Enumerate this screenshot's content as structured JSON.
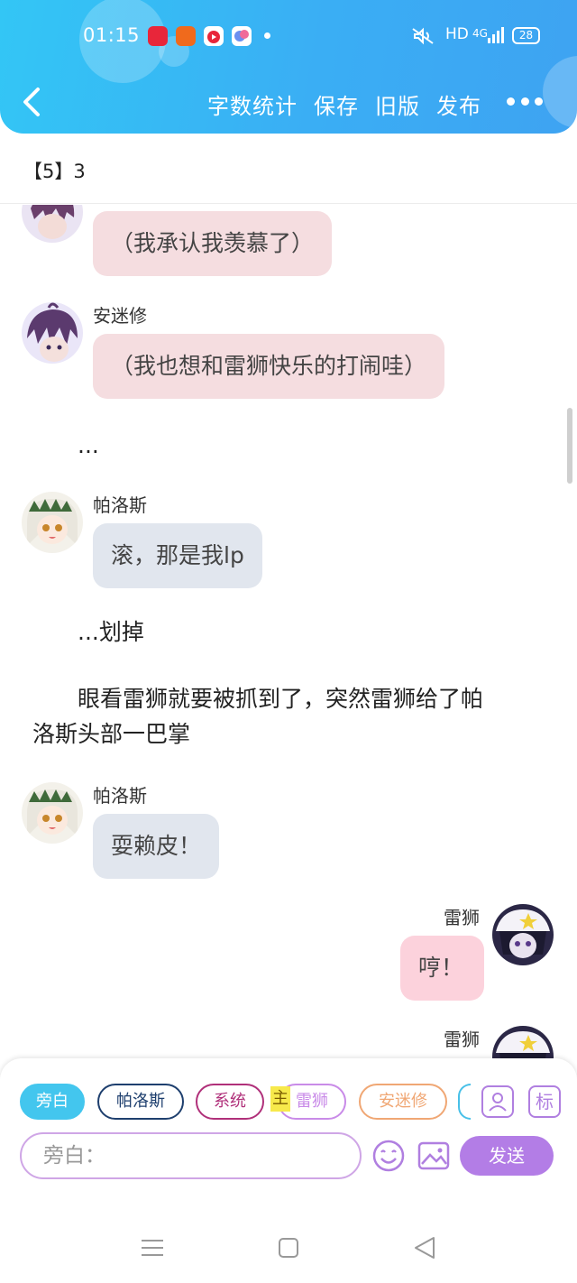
{
  "status_bar": {
    "time": "01:15",
    "network": "HD",
    "signal": "4G",
    "battery": "28"
  },
  "header": {
    "actions": [
      "字数统计",
      "保存",
      "旧版",
      "发布"
    ]
  },
  "chapter": {
    "title": "【5】3"
  },
  "messages": [
    {
      "speaker": "",
      "text": "（我承认我羡慕了）",
      "side": "left",
      "style": "pink"
    },
    {
      "speaker": "安迷修",
      "text": "（我也想和雷狮快乐的打闹哇）",
      "side": "left",
      "style": "pink"
    },
    {
      "narration": "..."
    },
    {
      "speaker": "帕洛斯",
      "text": "滚，那是我lp",
      "side": "left",
      "style": "gray"
    },
    {
      "narration": "...划掉"
    },
    {
      "narration_line1": "眼看雷狮就要被抓到了，突然雷狮给了帕",
      "narration_line2": "洛斯头部一巴掌"
    },
    {
      "speaker": "帕洛斯",
      "text": "耍赖皮！",
      "side": "left",
      "style": "gray"
    },
    {
      "speaker": "雷狮",
      "text": "哼！",
      "side": "right",
      "style": "pink"
    },
    {
      "speaker": "雷狮",
      "text": "",
      "side": "right",
      "style": "pink"
    }
  ],
  "roles": [
    {
      "label": "旁白",
      "color": "#43c6ee",
      "active": true
    },
    {
      "label": "帕洛斯",
      "color": "#1e3f6e",
      "active": false
    },
    {
      "label": "系统",
      "color": "#b0307a",
      "active": false
    },
    {
      "label": "雷狮",
      "color": "#c98be8",
      "active": false
    },
    {
      "label": "安迷修",
      "color": "#f0a774",
      "active": false
    }
  ],
  "main_tag": "主",
  "tools": {
    "mark_label": "标"
  },
  "input": {
    "placeholder": "旁白："
  },
  "send_label": "发送",
  "colors": {
    "header_blue": "#3aaef4",
    "accent_purple": "#b37de6",
    "bubble_pink": "#f5dde0",
    "bubble_gray": "#e1e6ee"
  }
}
